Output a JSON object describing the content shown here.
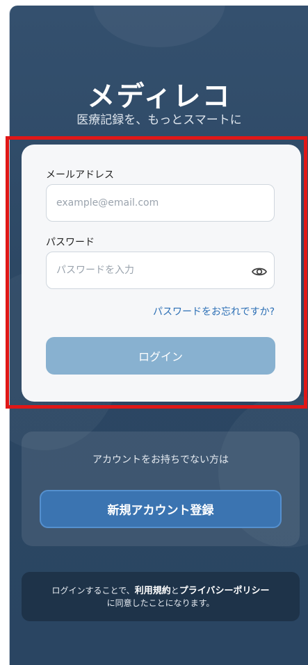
{
  "app": {
    "title": "メディレコ",
    "subtitle": "医療記録を、もっとスマートに"
  },
  "login_form": {
    "email_label": "メールアドレス",
    "email_placeholder": "example@email.com",
    "email_value": "",
    "password_label": "パスワード",
    "password_placeholder": "パスワードを入力",
    "password_value": "",
    "forgot_password_link": "パスワードをお忘れですか?",
    "login_button": "ログイン"
  },
  "signup": {
    "prompt": "アカウントをお持ちでない方は",
    "button": "新規アカウント登録"
  },
  "terms": {
    "prefix": "ログインすることで、",
    "terms_link": "利用規約",
    "and": "と",
    "privacy_link": "プライバシーポリシー",
    "suffix": "に同意したことになります。"
  },
  "icons": {
    "password_toggle": "eye-icon"
  },
  "colors": {
    "highlight": "#e01717",
    "accent": "#2c6fb5",
    "login_button": "#88b1d0",
    "signup_button": "#3b74b1"
  }
}
